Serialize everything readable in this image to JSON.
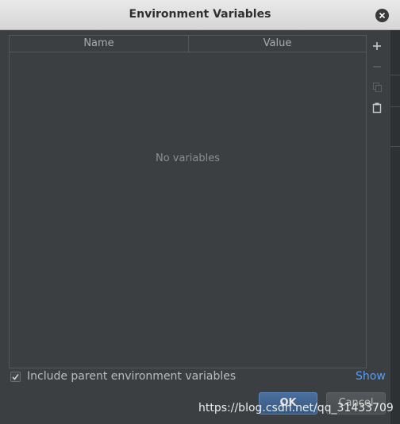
{
  "dialog": {
    "title": "Environment Variables"
  },
  "table": {
    "columns": [
      "Name",
      "Value"
    ],
    "empty_text": "No variables"
  },
  "toolbar": {
    "items": [
      {
        "icon": "add-icon",
        "enabled": true
      },
      {
        "icon": "remove-icon",
        "enabled": false
      },
      {
        "icon": "copy-icon",
        "enabled": false
      },
      {
        "icon": "paste-icon",
        "enabled": true
      }
    ]
  },
  "include_parent": {
    "label": "Include parent environment variables",
    "checked": true
  },
  "show_link": "Show",
  "buttons": {
    "ok": "OK",
    "cancel": "Cancel"
  },
  "watermark": "https://blog.csdn.net/qq_31433709",
  "colors": {
    "background": "#3c3f41",
    "accent": "#589df6",
    "ok_button": "#365880"
  }
}
